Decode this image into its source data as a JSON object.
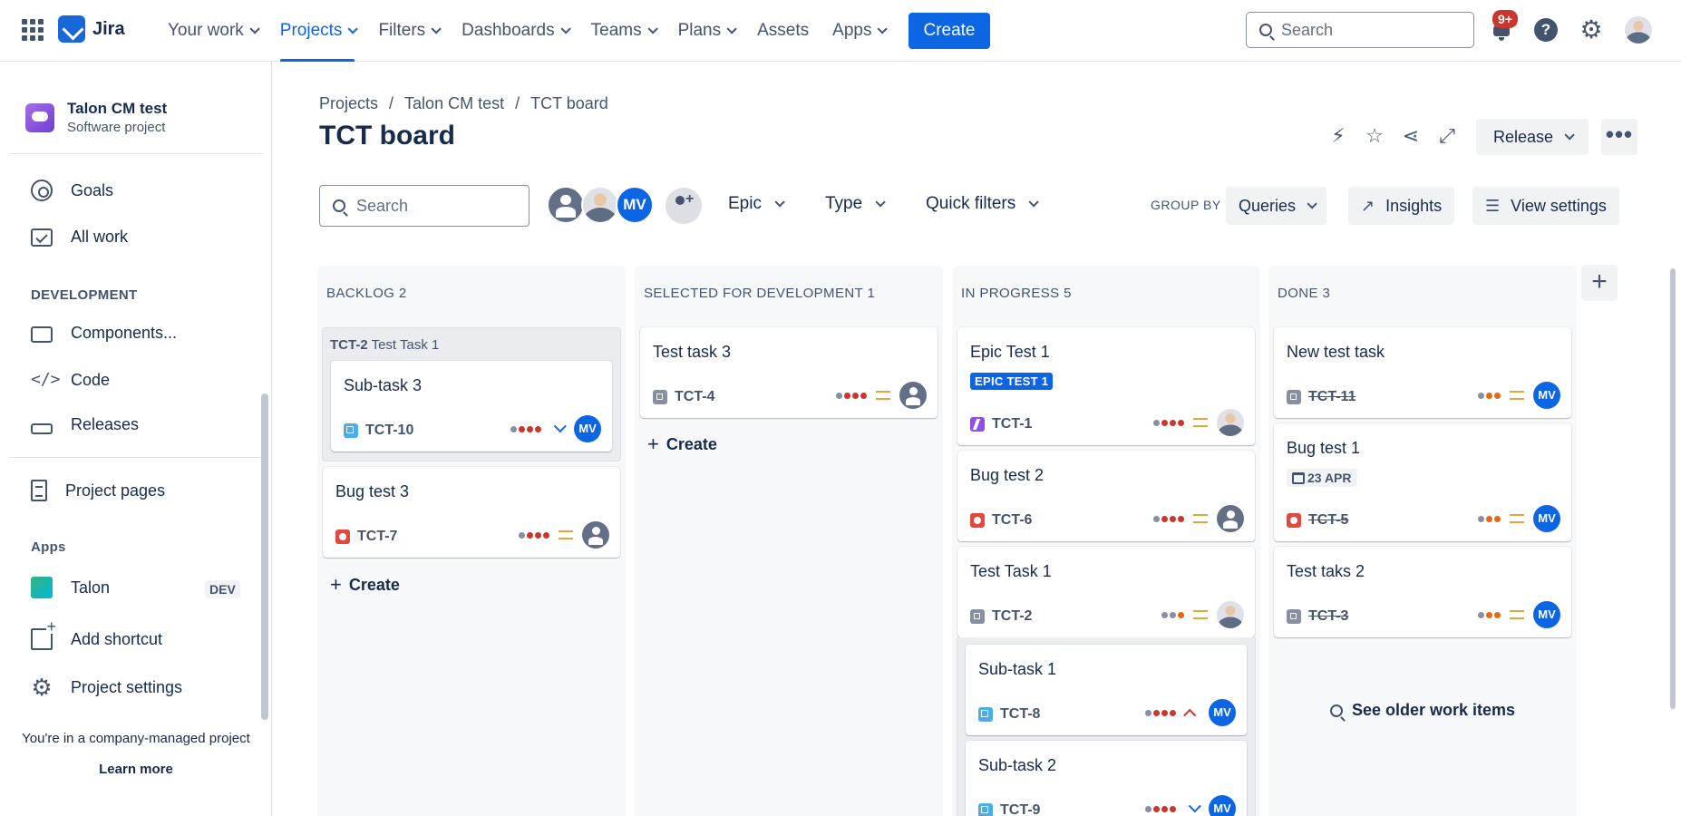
{
  "topnav": {
    "logo_text": "Jira",
    "items": [
      {
        "label": "Your work",
        "chevron": true,
        "active": false
      },
      {
        "label": "Projects",
        "chevron": true,
        "active": true
      },
      {
        "label": "Filters",
        "chevron": true,
        "active": false
      },
      {
        "label": "Dashboards",
        "chevron": true,
        "active": false
      },
      {
        "label": "Teams",
        "chevron": true,
        "active": false
      },
      {
        "label": "Plans",
        "chevron": true,
        "active": false
      },
      {
        "label": "Assets",
        "chevron": false,
        "active": false
      },
      {
        "label": "Apps",
        "chevron": true,
        "active": false
      }
    ],
    "create_label": "Create",
    "search_placeholder": "Search",
    "notification_badge": "9+",
    "help_glyph": "?"
  },
  "sidebar": {
    "project_name": "Talon CM test",
    "project_type": "Software project",
    "items": {
      "goals": "Goals",
      "all_work": "All work",
      "development_heading": "DEVELOPMENT",
      "components": "Components...",
      "code": "Code",
      "releases": "Releases",
      "project_pages": "Project pages",
      "apps_heading": "Apps",
      "talon": "Talon",
      "talon_tag": "DEV",
      "add_shortcut": "Add shortcut",
      "project_settings": "Project settings"
    },
    "footer_text": "You're in a company-managed project",
    "learn_more": "Learn more"
  },
  "header": {
    "breadcrumbs": [
      "Projects",
      "Talon CM test",
      "TCT board"
    ],
    "breadcrumb_sep": "/",
    "title": "TCT board",
    "release_label": "Release",
    "more_glyph": "•••"
  },
  "toolbar": {
    "search_placeholder": "Search",
    "avatar_mv": "MV",
    "filters": [
      "Epic",
      "Type",
      "Quick filters"
    ],
    "group_by_label": "GROUP BY",
    "group_by_value": "Queries",
    "insights_label": "Insights",
    "view_settings_label": "View settings"
  },
  "columns": [
    {
      "title": "BACKLOG 2",
      "create_label": "Create"
    },
    {
      "title": "SELECTED FOR DEVELOPMENT 1",
      "create_label": "Create"
    },
    {
      "title": "IN PROGRESS 5"
    },
    {
      "title": "DONE 3",
      "older_label": "See older work items"
    }
  ],
  "cards": {
    "backlog_parent": {
      "key": "TCT-2",
      "title": "Test Task 1"
    },
    "subtask3": {
      "title": "Sub-task 3",
      "key": "TCT-10",
      "assignee": "MV",
      "priority": "low"
    },
    "bugtest3": {
      "title": "Bug test 3",
      "key": "TCT-7",
      "priority": "medium"
    },
    "testtask3": {
      "title": "Test task 3",
      "key": "TCT-4",
      "priority": "medium"
    },
    "epictest1": {
      "title": "Epic Test 1",
      "epic_label": "EPIC TEST 1",
      "key": "TCT-1",
      "priority": "medium"
    },
    "bugtest2": {
      "title": "Bug test 2",
      "key": "TCT-6",
      "priority": "medium"
    },
    "testtask1": {
      "title": "Test Task 1",
      "key": "TCT-2",
      "priority": "medium"
    },
    "subtask1": {
      "title": "Sub-task 1",
      "key": "TCT-8",
      "assignee": "MV",
      "priority": "high"
    },
    "subtask2": {
      "title": "Sub-task 2",
      "key": "TCT-9",
      "assignee": "MV",
      "priority": "low"
    },
    "newtesttask": {
      "title": "New test task",
      "key": "TCT-11",
      "assignee": "MV",
      "priority": "medium"
    },
    "bugtest1": {
      "title": "Bug test 1",
      "due": "23 APR",
      "key": "TCT-5",
      "assignee": "MV",
      "priority": "medium"
    },
    "testtaks2": {
      "title": "Test taks 2",
      "key": "TCT-3",
      "assignee": "MV",
      "priority": "medium"
    }
  },
  "colors": {
    "brand": "#0c66e4",
    "bug": "#e2483d",
    "subtask": "#4bade8",
    "epic": "#904ee2",
    "task": "#8590a2",
    "priority_medium": "#e2a63b"
  }
}
